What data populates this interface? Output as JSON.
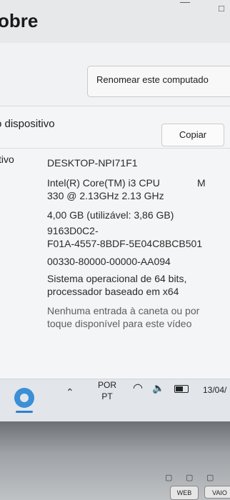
{
  "window": {
    "title": "obre",
    "minimize_icon": "minimize-icon",
    "close_icon": "close-icon"
  },
  "header": {
    "rename_button": "Renomear este computado"
  },
  "device_section": {
    "title": "o dispositivo",
    "copy_button": "Copiar",
    "row_label": "tivo",
    "specs": {
      "device_name": "DESKTOP-NPI71F1",
      "processor_line1": "Intel(R) Core(TM) i3 CPU",
      "processor_m": "M",
      "processor_line2": "330  @ 2.13GHz   2.13 GHz",
      "ram": "4,00 GB (utilizável: 3,86 GB)",
      "device_id_line1": "9163D0C2-",
      "device_id_line2": "F01A-4557-8BDF-5E04C8BCB501",
      "product_id": "00330-80000-00000-AA094",
      "system_type": "Sistema operacional de 64 bits, processador baseado em x64",
      "pen_touch": "Nenhuma entrada à caneta ou por toque disponível para este vídeo"
    }
  },
  "taskbar": {
    "settings_icon": "gear-icon",
    "language_line1": "POR",
    "language_line2": "PT",
    "date": "13/04/"
  },
  "bezel": {
    "web_key": "WEB",
    "vaio_key": "VAIO"
  },
  "colors": {
    "accent": "#2d7fd0",
    "screen_background": "#f1f2f3",
    "bezel": "#9ea2a6"
  }
}
